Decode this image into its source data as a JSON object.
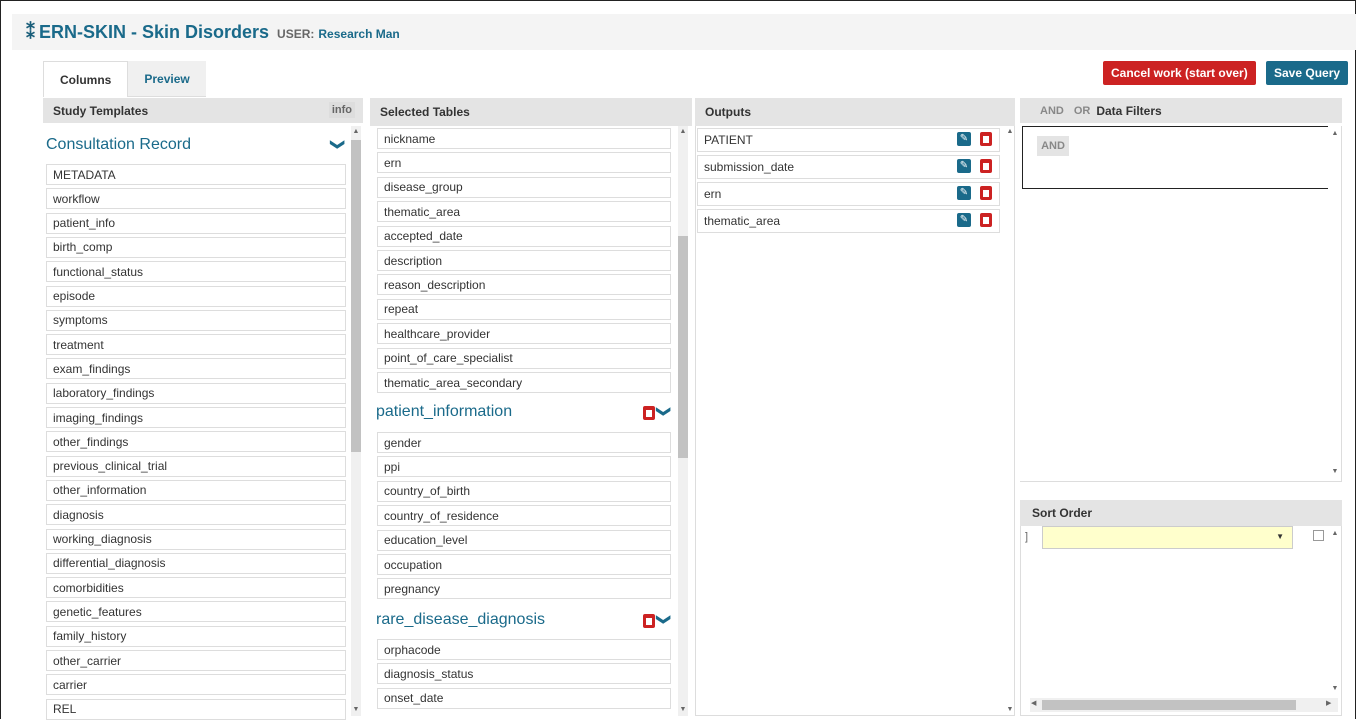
{
  "header": {
    "title": "ERN-SKIN - Skin Disorders",
    "user_label": "USER:",
    "user_name": "Research Man"
  },
  "tabs": [
    {
      "label": "Columns",
      "active": true
    },
    {
      "label": "Preview",
      "active": false
    }
  ],
  "actions": {
    "cancel_label": "Cancel work (start over)",
    "save_label": "Save Query"
  },
  "study_templates": {
    "title": "Study Templates",
    "info_label": "info",
    "group_title": "Consultation Record",
    "items": [
      "METADATA",
      "workflow",
      "patient_info",
      "birth_comp",
      "functional_status",
      "episode",
      "symptoms",
      "treatment",
      "exam_findings",
      "laboratory_findings",
      "imaging_findings",
      "other_findings",
      "previous_clinical_trial",
      "other_information",
      "diagnosis",
      "working_diagnosis",
      "differential_diagnosis",
      "comorbidities",
      "genetic_features",
      "family_history",
      "other_carrier",
      "carrier",
      "REL"
    ]
  },
  "selected_tables": {
    "title": "Selected Tables",
    "group1_items": [
      "nickname",
      "ern",
      "disease_group",
      "thematic_area",
      "accepted_date",
      "description",
      "reason_description",
      "repeat",
      "healthcare_provider",
      "point_of_care_specialist",
      "thematic_area_secondary"
    ],
    "group2_title": "patient_information",
    "group2_items": [
      "gender",
      "ppi",
      "country_of_birth",
      "country_of_residence",
      "education_level",
      "occupation",
      "pregnancy"
    ],
    "group3_title": "rare_disease_diagnosis",
    "group3_items": [
      "orphacode",
      "diagnosis_status",
      "onset_date"
    ]
  },
  "outputs": {
    "title": "Outputs",
    "items": [
      "PATIENT",
      "submission_date",
      "ern",
      "thematic_area"
    ]
  },
  "data_filters": {
    "and_label": "AND",
    "or_label": "OR",
    "title": "Data Filters",
    "group_and_label": "AND"
  },
  "sort_order": {
    "title": "Sort Order",
    "bracket": "]"
  },
  "colors": {
    "accent": "#1a6a8a",
    "danger": "#cc2222",
    "select_bg": "#ffffcc"
  }
}
